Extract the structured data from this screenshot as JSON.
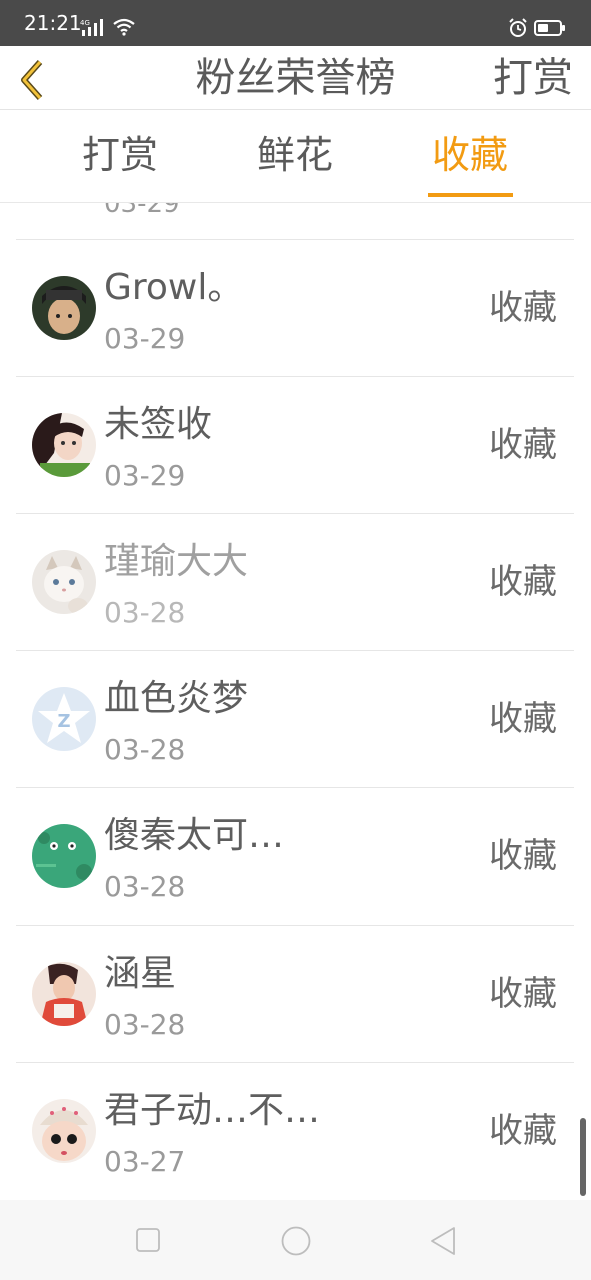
{
  "status_bar": {
    "time": "21:21",
    "network": "4G",
    "icons": [
      "signal-icon",
      "wifi-icon",
      "alarm-icon",
      "battery-icon"
    ]
  },
  "header": {
    "back_icon": "chevron-left-icon",
    "title": "粉丝荣誉榜",
    "action_label": "打赏"
  },
  "tabs": [
    {
      "label": "打赏",
      "active": false
    },
    {
      "label": "鲜花",
      "active": false
    },
    {
      "label": "收藏",
      "active": true
    }
  ],
  "colors": {
    "accent": "#f29b12",
    "text": "#5a5a5a",
    "secondary_text": "#9a9a9a",
    "status_bar": "#4a4a4a"
  },
  "list": {
    "partial_date": "03-29",
    "items": [
      {
        "name": "Growl。",
        "date": "03-29",
        "action": "收藏"
      },
      {
        "name": "未签收",
        "date": "03-29",
        "action": "收藏"
      },
      {
        "name": "瑾瑜大大",
        "date": "03-28",
        "action": "收藏"
      },
      {
        "name": "血色炎梦",
        "date": "03-28",
        "action": "收藏"
      },
      {
        "name": "傻秦太可…",
        "date": "03-28",
        "action": "收藏"
      },
      {
        "name": "涵星",
        "date": "03-28",
        "action": "收藏"
      },
      {
        "name": "君子动…不…",
        "date": "03-27",
        "action": "收藏"
      }
    ]
  },
  "nav_bar": {
    "icons": [
      "recent-apps-icon",
      "home-icon",
      "back-icon"
    ]
  }
}
